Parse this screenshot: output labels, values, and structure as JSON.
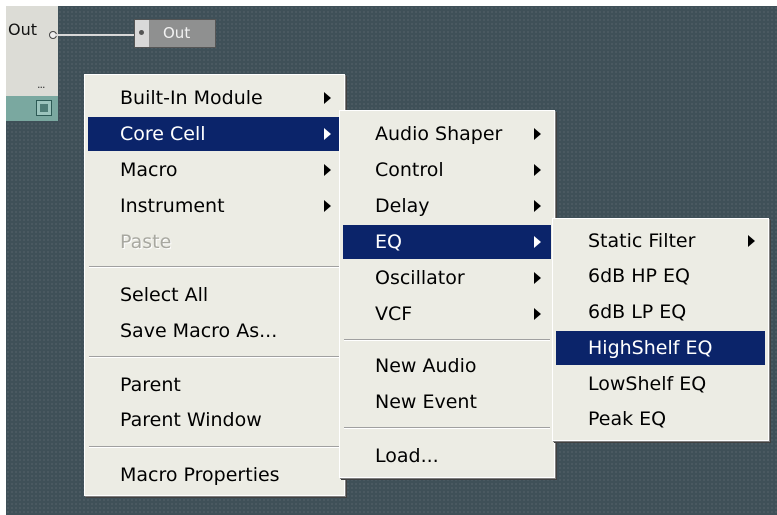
{
  "canvas": {
    "module_out_label": "Out",
    "module_dots": "...",
    "out_module_label": "Out"
  },
  "menu_main": {
    "items": [
      {
        "label": "Built-In Module",
        "submenu": true
      },
      {
        "label": "Core Cell",
        "submenu": true,
        "highlighted": true
      },
      {
        "label": "Macro",
        "submenu": true
      },
      {
        "label": "Instrument",
        "submenu": true
      },
      {
        "label": "Paste",
        "disabled": true
      },
      {
        "label": "Select All"
      },
      {
        "label": "Save Macro As..."
      },
      {
        "label": "Parent"
      },
      {
        "label": "Parent Window"
      },
      {
        "label": "Macro Properties"
      }
    ]
  },
  "menu_core_cell": {
    "items": [
      {
        "label": "Audio Shaper",
        "submenu": true
      },
      {
        "label": "Control",
        "submenu": true
      },
      {
        "label": "Delay",
        "submenu": true
      },
      {
        "label": "EQ",
        "submenu": true,
        "highlighted": true
      },
      {
        "label": "Oscillator",
        "submenu": true
      },
      {
        "label": "VCF",
        "submenu": true
      },
      {
        "label": "New Audio"
      },
      {
        "label": "New Event"
      },
      {
        "label": "Load..."
      }
    ]
  },
  "menu_eq": {
    "items": [
      {
        "label": "Static Filter",
        "submenu": true
      },
      {
        "label": "6dB HP EQ"
      },
      {
        "label": "6dB LP EQ"
      },
      {
        "label": "HighShelf EQ",
        "highlighted": true
      },
      {
        "label": "LowShelf EQ"
      },
      {
        "label": "Peak EQ"
      }
    ]
  },
  "colors": {
    "canvas_bg": "#3f5058",
    "menu_bg": "#ecece4",
    "highlight": "#0b246a"
  }
}
